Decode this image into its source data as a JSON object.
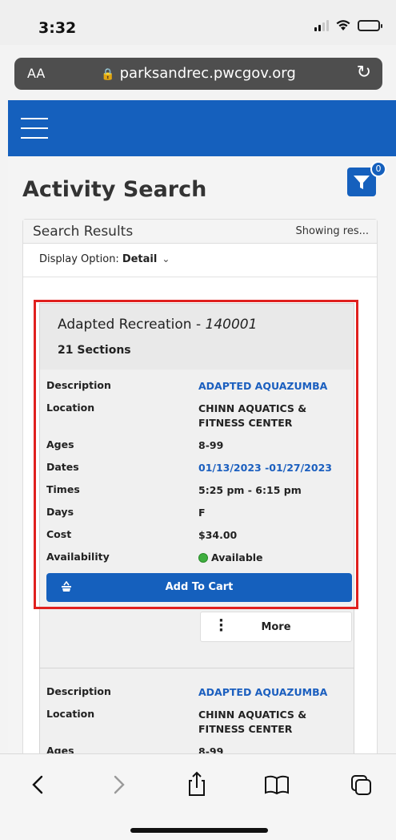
{
  "status": {
    "time": "3:32"
  },
  "browser": {
    "text_size_label": "AA",
    "url": "parksandrec.pwcgov.org"
  },
  "page": {
    "title": "Activity Search",
    "filter_badge": "0"
  },
  "results": {
    "title": "Search Results",
    "showing": "Showing res...",
    "display_label": "Display Option:",
    "display_value": "Detail"
  },
  "activity": {
    "name": "Adapted Recreation - ",
    "code": "140001",
    "sections": "21 Sections"
  },
  "labels": {
    "description": "Description",
    "location": "Location",
    "ages": "Ages",
    "dates": "Dates",
    "times": "Times",
    "days": "Days",
    "cost": "Cost",
    "availability": "Availability",
    "add_to_cart": "Add To Cart",
    "more": "More"
  },
  "section1": {
    "description": "ADAPTED AQUAZUMBA",
    "location": "CHINN AQUATICS & FITNESS CENTER",
    "ages": "8-99",
    "dates": "01/13/2023 -01/27/2023",
    "times": "5:25 pm - 6:15 pm",
    "days": "F",
    "cost": "$34.00",
    "availability": "Available"
  },
  "section2": {
    "description": "ADAPTED AQUAZUMBA",
    "location": "CHINN AQUATICS & FITNESS CENTER",
    "ages": "8-99"
  },
  "colors": {
    "brand_blue": "#1560bd",
    "link_blue": "#1b5fbf",
    "highlight_red": "#e0201e",
    "available_green": "#3fae3f"
  }
}
